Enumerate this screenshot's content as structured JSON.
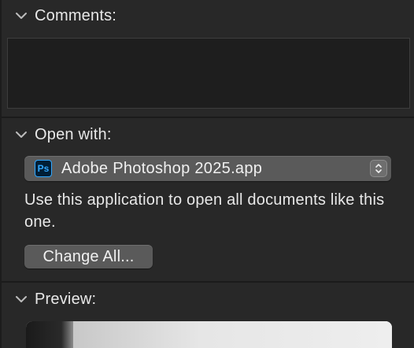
{
  "comments": {
    "title": "Comments:",
    "text": ""
  },
  "open_with": {
    "title": "Open with:",
    "selected_app": "Adobe Photoshop 2025.app",
    "app_icon_text": "Ps",
    "app_icon": "photoshop-icon",
    "description": "Use this application to open all documents like this one.",
    "change_all_label": "Change All..."
  },
  "preview": {
    "title": "Preview:"
  },
  "icons": {
    "section_toggle": "chevron-down-icon",
    "stepper": "up-down-stepper-icon"
  },
  "colors": {
    "background": "#282828",
    "control": "#5a5a5a",
    "photoshop_blue": "#31a8ff",
    "photoshop_bg": "#001e36"
  }
}
